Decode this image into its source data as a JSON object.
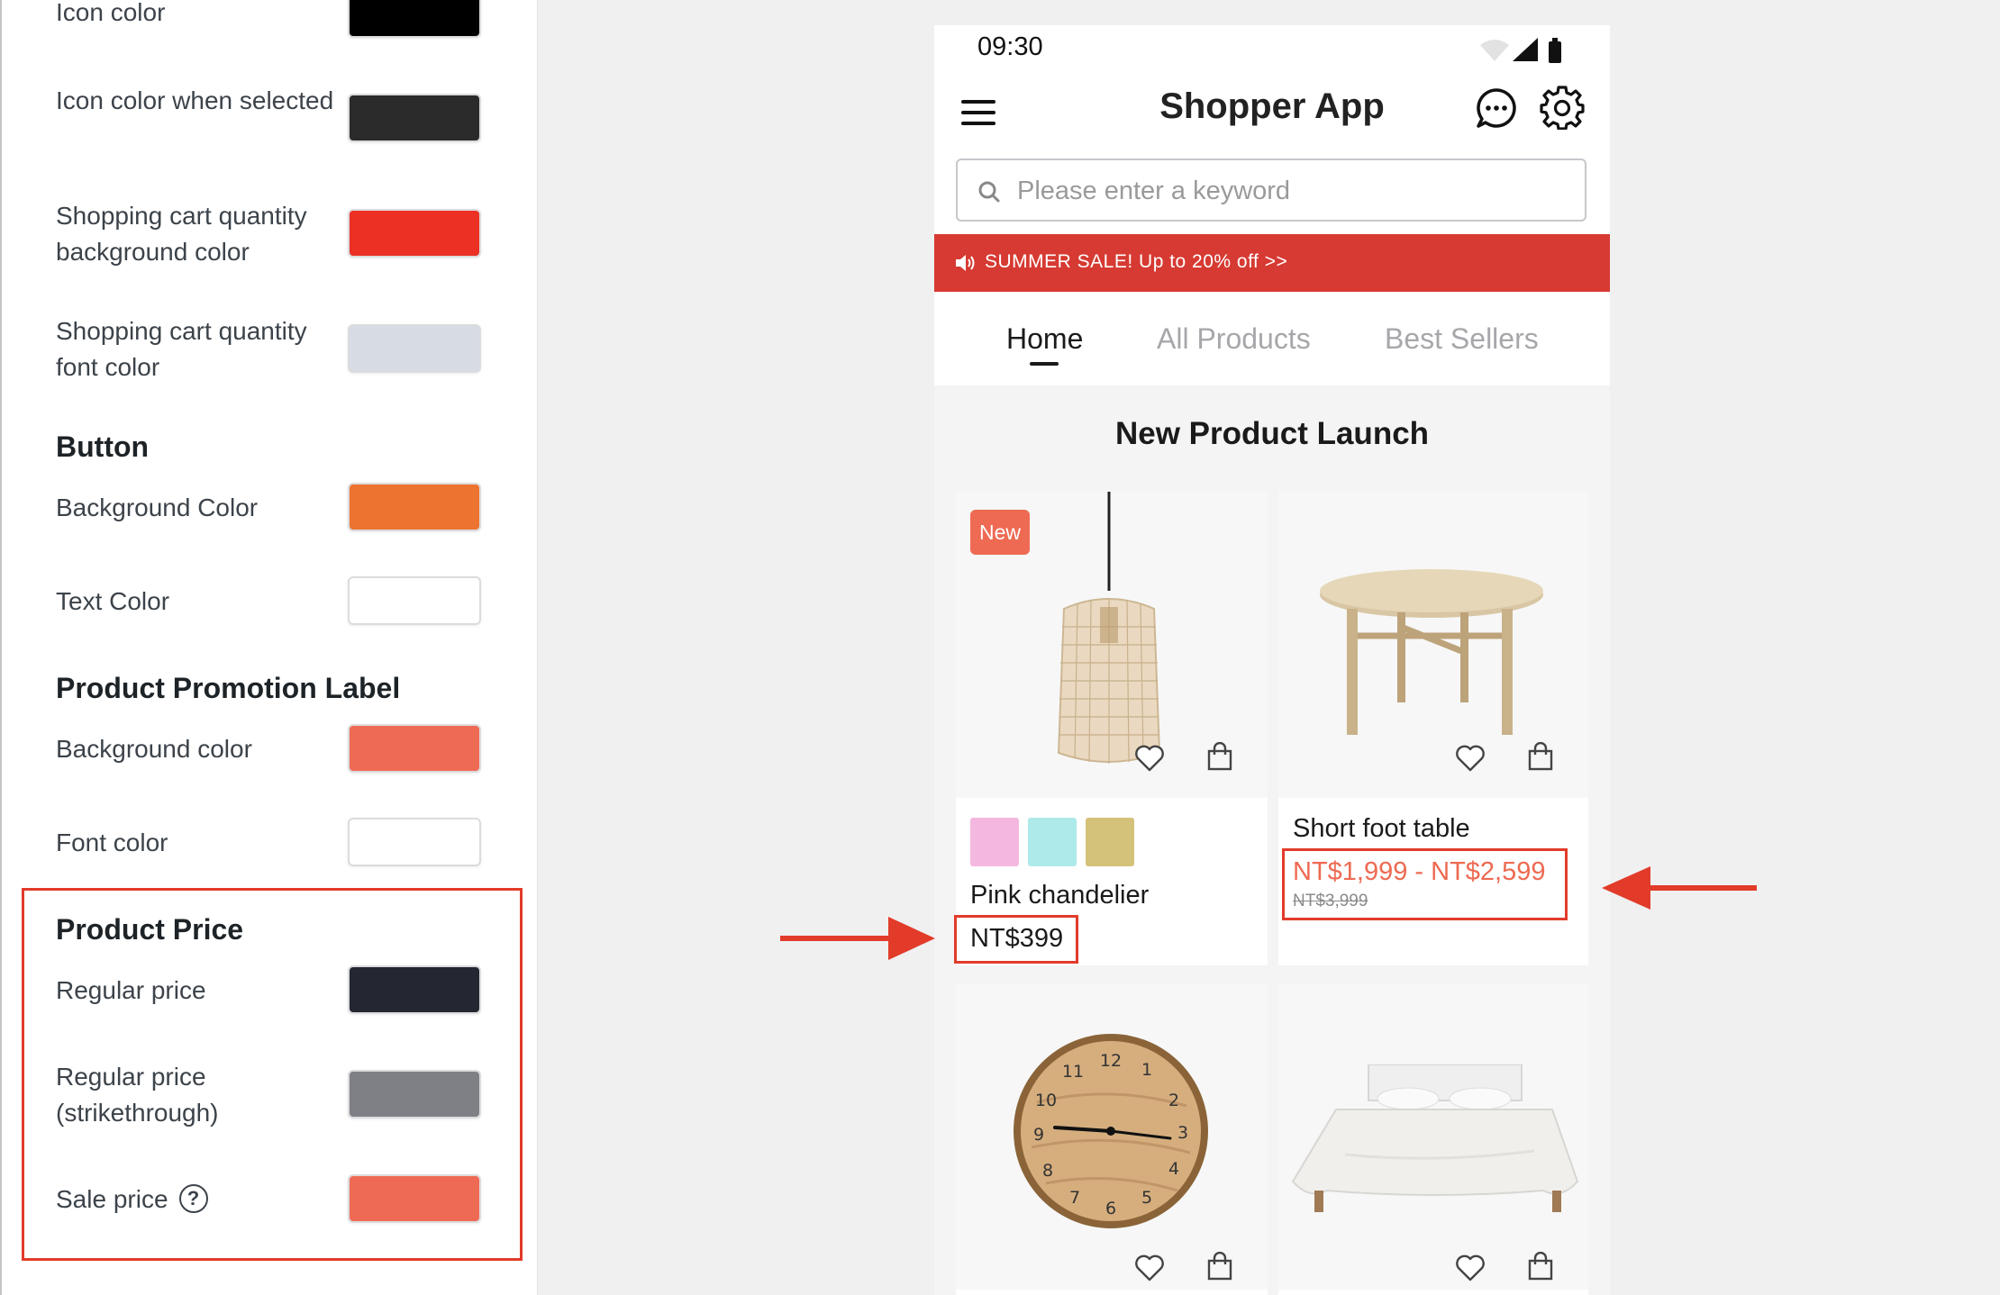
{
  "settings": {
    "rows": [
      {
        "label": "Icon color",
        "color": "#000000"
      },
      {
        "label": "Icon color when selected",
        "color": "#2b2b2b"
      },
      {
        "label": "Shopping cart quantity background color",
        "color": "#ec3024"
      },
      {
        "label": "Shopping cart quantity font color",
        "color": "#d7dce4"
      }
    ],
    "button": {
      "heading": "Button",
      "background_label": "Background Color",
      "background_color": "#ec7330",
      "text_label": "Text Color",
      "text_color": "#ffffff"
    },
    "promo": {
      "heading": "Product Promotion Label",
      "background_label": "Background color",
      "background_color": "#ef6a55",
      "font_label": "Font color",
      "font_color": "#ffffff"
    },
    "price": {
      "heading": "Product Price",
      "regular_label": "Regular price",
      "regular_color": "#242631",
      "strike_label": "Regular price (strikethrough)",
      "strike_color": "#7e8085",
      "sale_label": "Sale price",
      "sale_color": "#ef6a55",
      "help_icon": "?"
    }
  },
  "phone": {
    "time": "09:30",
    "title": "Shopper App",
    "search_placeholder": "Please enter a keyword",
    "banner": "SUMMER SALE! Up to 20% off >>",
    "tabs": [
      "Home",
      "All Products",
      "Best Sellers"
    ],
    "active_tab": "Home",
    "section_title": "New Product Launch",
    "products": [
      {
        "name": "Pink chandelier",
        "badge": "New",
        "price": "NT$399",
        "swatches": [
          "#f4b8e0",
          "#aeeaea",
          "#d4c27a"
        ]
      },
      {
        "name": "Short foot table",
        "sale_price": "NT$1,999 - NT$2,599",
        "regular_price": "NT$3,999"
      },
      {
        "name": "Wall clock"
      },
      {
        "name": "Bed"
      }
    ],
    "icons": {
      "menu": "hamburger-icon",
      "chat": "chat-bubble-icon",
      "settings": "gear-icon",
      "search": "search-icon",
      "wishlist": "heart-icon",
      "cart": "shopping-bag-icon"
    }
  },
  "annotation": {
    "highlight_color": "#e23b2a"
  }
}
